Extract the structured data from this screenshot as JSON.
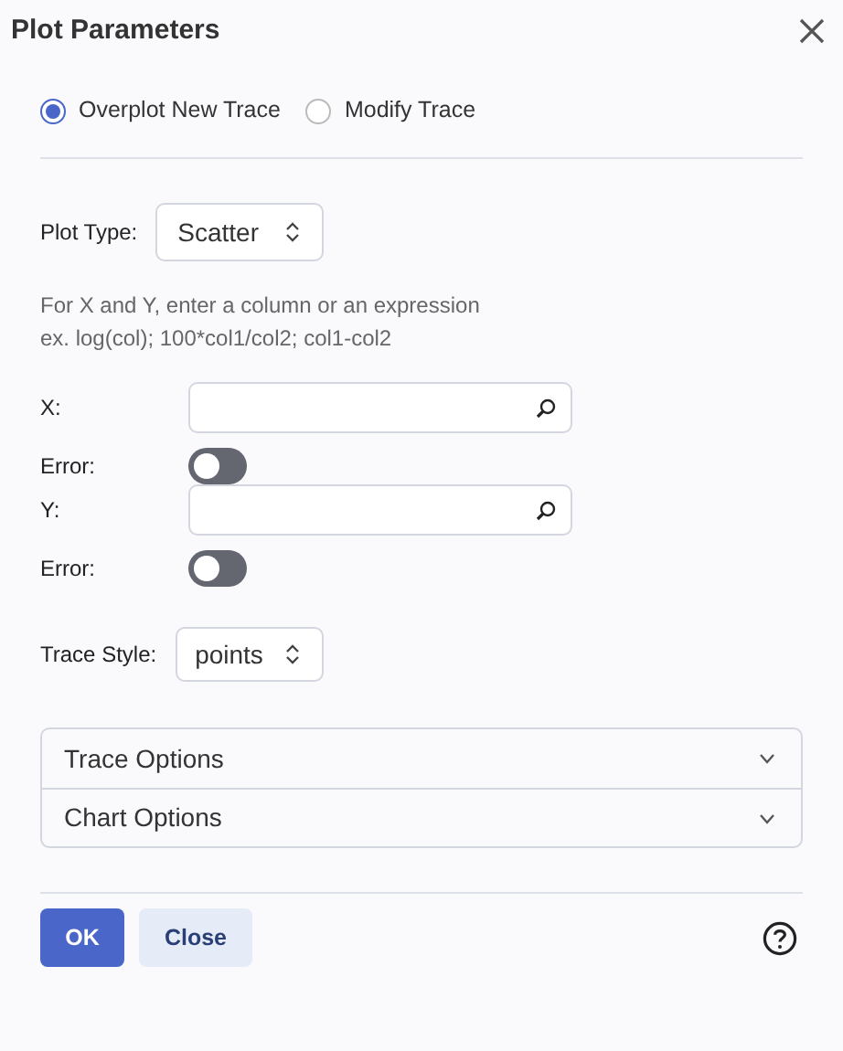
{
  "window": {
    "title": "Plot Parameters"
  },
  "mode_options": [
    {
      "label": "Overplot New Trace",
      "selected": true
    },
    {
      "label": "Modify Trace",
      "selected": false
    }
  ],
  "plot_type": {
    "label": "Plot Type:",
    "value": "Scatter"
  },
  "hint": [
    "For X and Y, enter a column or an expression",
    "ex. log(col); 100*col1/col2; col1-col2"
  ],
  "axes": [
    {
      "label": "X:",
      "error_label": "Error:",
      "error_on": false
    },
    {
      "label": "Y:",
      "error_label": "Error:",
      "error_on": false
    }
  ],
  "trace_style": {
    "label": "Trace Style:",
    "value": "points"
  },
  "sections": [
    {
      "label": "Trace Options",
      "expanded": false
    },
    {
      "label": "Chart Options",
      "expanded": false
    }
  ],
  "buttons": [
    {
      "label": "OK",
      "kind": "primary"
    },
    {
      "label": "Close",
      "kind": "secondary"
    }
  ]
}
